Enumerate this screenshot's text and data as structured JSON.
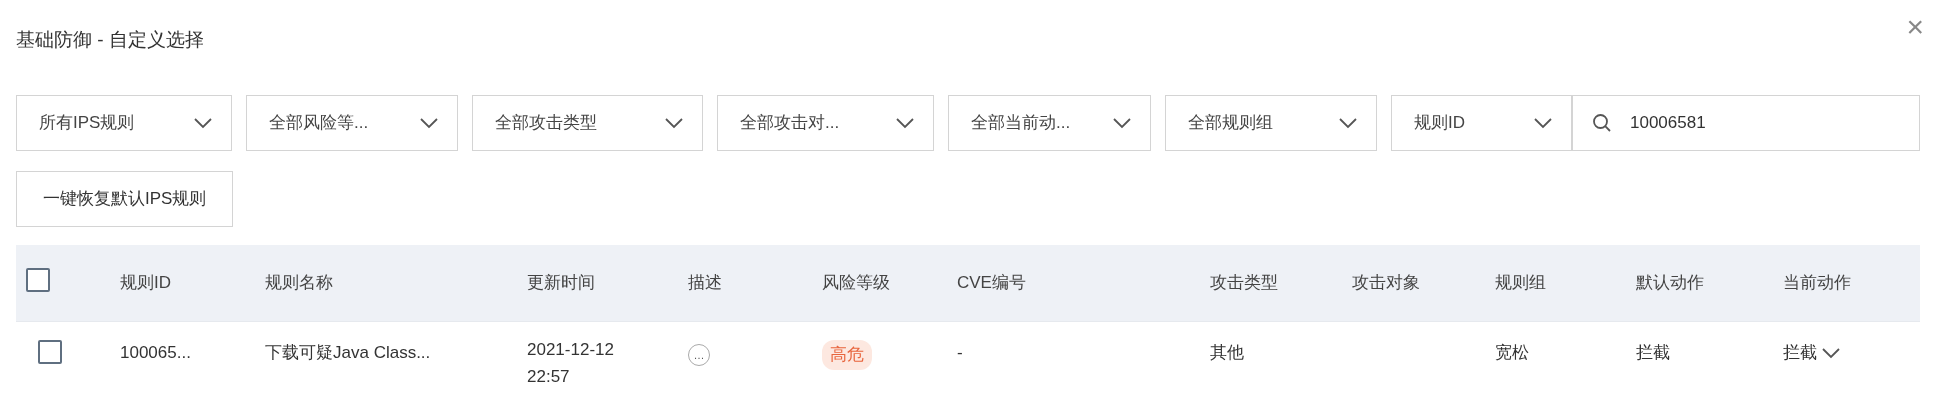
{
  "dialog": {
    "title": "基础防御 - 自定义选择",
    "close": "×"
  },
  "filters": [
    {
      "label": "所有IPS规则"
    },
    {
      "label": "全部风险等..."
    },
    {
      "label": "全部攻击类型"
    },
    {
      "label": "全部攻击对..."
    },
    {
      "label": "全部当前动..."
    },
    {
      "label": "全部规则组"
    }
  ],
  "search": {
    "field": "规则ID",
    "value": "10006581"
  },
  "restore_button": "一键恢复默认IPS规则",
  "table": {
    "select_all_checked": false,
    "columns": [
      "规则ID",
      "规则名称",
      "更新时间",
      "描述",
      "风险等级",
      "CVE编号",
      "攻击类型",
      "攻击对象",
      "规则组",
      "默认动作",
      "当前动作"
    ],
    "rows": [
      {
        "checked": false,
        "rule_id": "100065...",
        "rule_name": "下载可疑Java Class...",
        "updated": "2021-12-12 22:57",
        "description": "…",
        "risk": "高危",
        "cve": "-",
        "attack_type": "其他",
        "rule_group": "宽松",
        "default_action": "拦截",
        "current_action": "拦截"
      }
    ]
  }
}
